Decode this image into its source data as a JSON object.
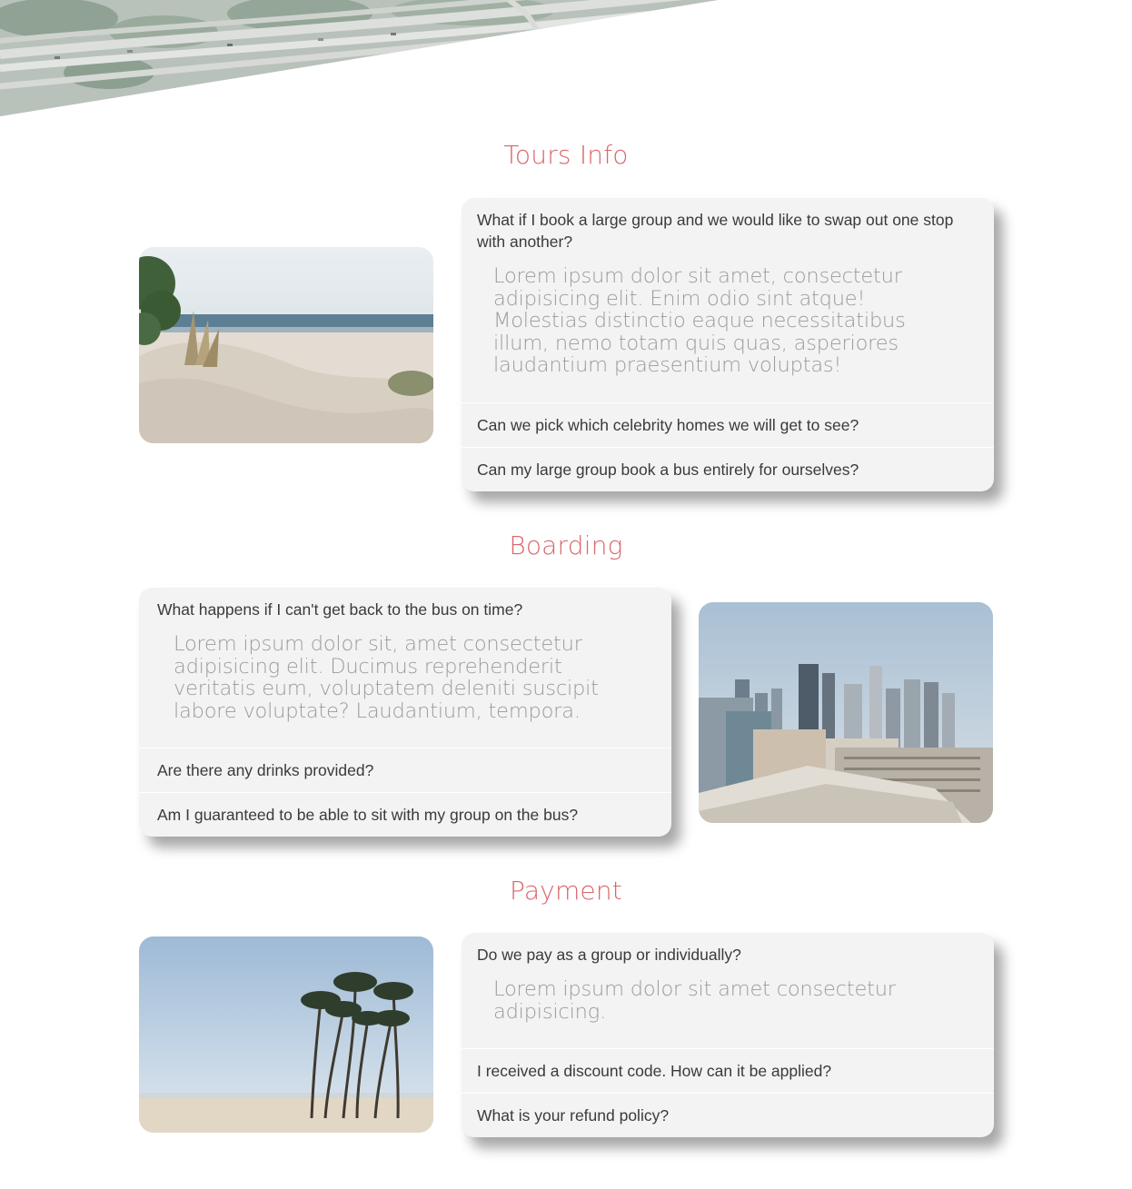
{
  "sections": [
    {
      "title": "Tours Info",
      "photo": "beach-dunes-photo",
      "items": [
        {
          "question": "What if I book a large group and we would like to swap out one stop with another?",
          "answer": "Lorem ipsum dolor sit amet, consectetur adipisicing elit. Enim odio sint atque! Molestias distinctio eaque necessitatibus illum, nemo totam quis quas, asperiores laudantium praesentium voluptas!",
          "expanded": true
        },
        {
          "question": "Can we pick which celebrity homes we will get to see?",
          "expanded": false
        },
        {
          "question": "Can my large group book a bus entirely for ourselves?",
          "expanded": false
        }
      ]
    },
    {
      "title": "Boarding",
      "photo": "city-skyline-photo",
      "items": [
        {
          "question": "What happens if I can't get back to the bus on time?",
          "answer": "Lorem ipsum dolor sit, amet consectetur adipisicing elit. Ducimus reprehenderit veritatis eum, voluptatem deleniti suscipit labore voluptate? Laudantium, tempora.",
          "expanded": true
        },
        {
          "question": "Are there any drinks provided?",
          "expanded": false
        },
        {
          "question": "Am I guaranteed to be able to sit with my group on the bus?",
          "expanded": false
        }
      ]
    },
    {
      "title": "Payment",
      "photo": "palm-trees-photo",
      "items": [
        {
          "question": "Do we pay as a group or individually?",
          "answer": "Lorem ipsum dolor sit amet consectetur adipisicing.",
          "expanded": true
        },
        {
          "question": "I received a discount code. How can it be applied?",
          "expanded": false
        },
        {
          "question": "What is your refund policy?",
          "expanded": false
        }
      ]
    }
  ],
  "colors": {
    "title": "#d9666b",
    "card_bg": "#f3f3f3",
    "question_text": "#3a3a3a",
    "answer_text": "#9b9b9b"
  }
}
